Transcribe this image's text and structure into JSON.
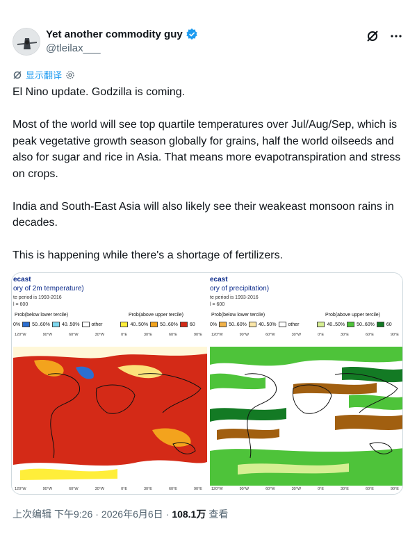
{
  "tweet": {
    "display_name": "Yet another commodity guy",
    "handle": "@tleilax___",
    "translate_label": "显示翻译",
    "text_paragraphs": [
      "El Nino update. Godzilla is coming.",
      "Most of the world will see top quartile temperatures over Jul/Aug/Sep, which is peak vegetative growth season globally for grains, half the world oilseeds and also for sugar and rice in Asia. That means more evapotranspiration and stress on crops.",
      "India and South-East Asia will also likely see their weakeast monsoon rains in decades.",
      "This is happening while there's a shortage of fertilizers."
    ],
    "meta": {
      "edited": "上次编辑",
      "time": "下午9:26",
      "sep1": "·",
      "date": "2026年6月6日",
      "sep2": "·",
      "views": "108.1万",
      "views_label": "查看"
    }
  },
  "media": {
    "left": {
      "title1": "ecast",
      "title2": "ory of 2m temperature)",
      "sub1": "te period is 1993-2016",
      "sub2": "l = 600",
      "prob_low": "Prob(below lower tercile)",
      "prob_high": "Prob(above upper tercile)",
      "legend": [
        {
          "label": "0%",
          "color": "#ffffff"
        },
        {
          "label": "50..60%",
          "color": "#2c6fd1"
        },
        {
          "label": "40..50%",
          "color": "#7fd8ef"
        },
        {
          "label": "other",
          "color": "#ffffff"
        },
        {
          "label": "40..50%",
          "color": "#ffee3a"
        },
        {
          "label": "50..60%",
          "color": "#f3a31d"
        },
        {
          "label": "60",
          "color": "#d42a17"
        }
      ],
      "lons": [
        "120°W",
        "90°W",
        "60°W",
        "30°W",
        "0°E",
        "30°E",
        "60°E",
        "90°E"
      ]
    },
    "right": {
      "title1": "ecast",
      "title2": "ory of precipitation)",
      "sub1": "te period is 1993-2016",
      "sub2": "l = 600",
      "prob_low": "Prob(below lower tercile)",
      "prob_high": "Prob(above upper tercile)",
      "legend": [
        {
          "label": "0%",
          "color": "#ffffff"
        },
        {
          "label": "50..60%",
          "color": "#f1b24a"
        },
        {
          "label": "40..50%",
          "color": "#fbe7a9"
        },
        {
          "label": "other",
          "color": "#ffffff"
        },
        {
          "label": "40..50%",
          "color": "#d6ef93"
        },
        {
          "label": "50..60%",
          "color": "#4ec33a"
        },
        {
          "label": "60",
          "color": "#137a24"
        }
      ],
      "lons": [
        "120°W",
        "90°W",
        "60°W",
        "30°W",
        "0°E",
        "30°E",
        "60°E",
        "90°E"
      ]
    }
  }
}
